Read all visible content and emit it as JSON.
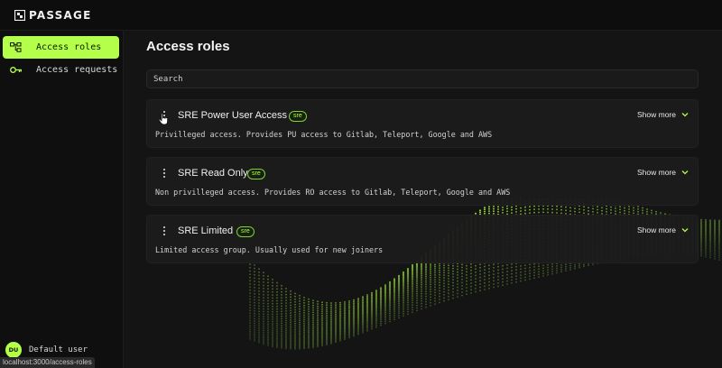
{
  "app": {
    "logo_text": "PASSAGE",
    "accent_color": "#b3ff4a",
    "logo_icon": "passage-logo-icon"
  },
  "sidebar": {
    "items": [
      {
        "label": "Access roles",
        "icon": "roles-tree-icon",
        "active": true
      },
      {
        "label": "Access requests",
        "icon": "key-icon",
        "active": false
      }
    ],
    "user": {
      "initials": "DU",
      "name": "Default user"
    }
  },
  "main": {
    "title": "Access roles",
    "search": {
      "placeholder": "Search",
      "value": ""
    },
    "roles": [
      {
        "name": "SRE Power User Access",
        "tag": "sre",
        "description": "Privilleged access. Provides PU access to Gitlab, Teleport, Google and AWS",
        "show_more": "Show more"
      },
      {
        "name": "SRE Read Only",
        "tag": "sre",
        "description": "Non privilleged access. Provides RO access to Gitlab, Teleport, Google and AWS",
        "show_more": "Show more"
      },
      {
        "name": "SRE Limited",
        "tag": "sre",
        "description": "Limited access group. Usually used for new joiners",
        "show_more": "Show more"
      }
    ]
  },
  "status_bar": {
    "url": "localhost:3000/access-roles"
  }
}
